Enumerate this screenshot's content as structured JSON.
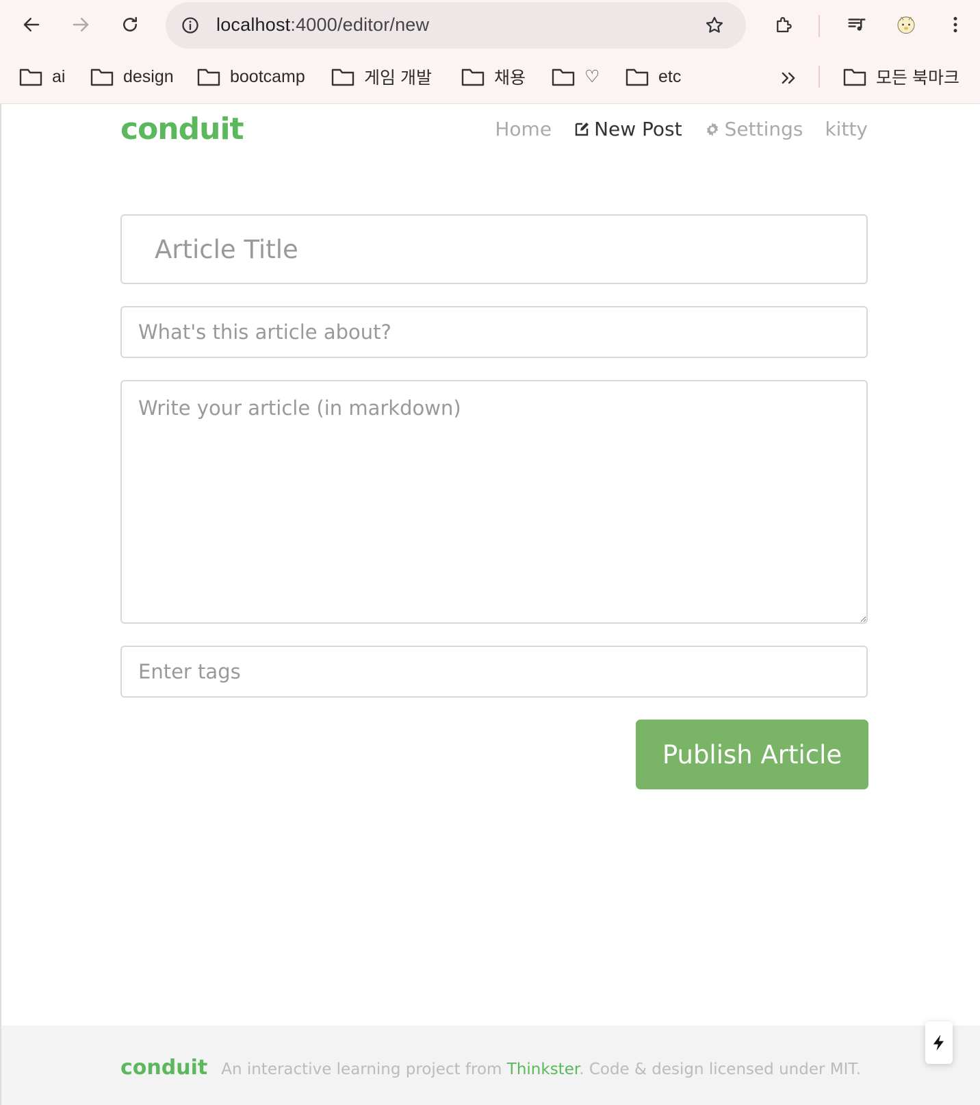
{
  "browser": {
    "url_host": "localhost",
    "url_rest": ":4000/editor/new",
    "bookmarks": [
      {
        "label": "ai"
      },
      {
        "label": "design"
      },
      {
        "label": "bootcamp"
      },
      {
        "label": "게임 개발"
      },
      {
        "label": "채용"
      },
      {
        "label": "♡"
      },
      {
        "label": "etc"
      }
    ],
    "all_bookmarks_label": "모든 북마크"
  },
  "nav": {
    "brand": "conduit",
    "home": "Home",
    "new_post": "New Post",
    "settings": "Settings",
    "user": "kitty"
  },
  "editor": {
    "title_placeholder": "Article Title",
    "about_placeholder": "What's this article about?",
    "body_placeholder": "Write your article (in markdown)",
    "tags_placeholder": "Enter tags",
    "publish_label": "Publish Article"
  },
  "footer": {
    "brand": "conduit",
    "text_before": "An interactive learning project from ",
    "link": "Thinkster",
    "text_after": ". Code & design licensed under MIT."
  },
  "colors": {
    "brand_green": "#5cb85c",
    "button_green": "#7ab567",
    "chrome_bg": "#fcf3f3"
  }
}
